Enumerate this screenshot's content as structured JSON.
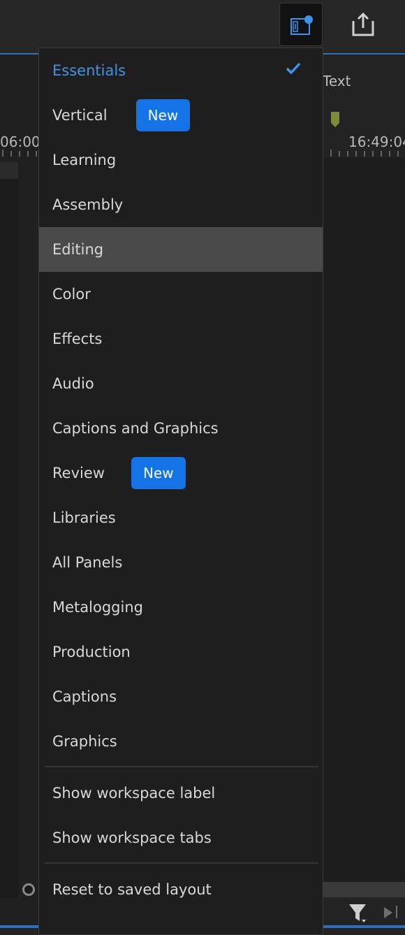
{
  "top_bar": {
    "workspaces_icon": "workspaces-icon",
    "share_icon": "share-export-icon",
    "accent_color": "#2c70c4"
  },
  "timeline": {
    "left_time": "06:00",
    "right_time": "16:49:04",
    "text_tab": "Text"
  },
  "menu": {
    "workspaces": [
      {
        "label": "Essentials",
        "selected": true,
        "badge": ""
      },
      {
        "label": "Vertical",
        "badge": "New"
      },
      {
        "label": "Learning",
        "badge": ""
      },
      {
        "label": "Assembly",
        "badge": ""
      },
      {
        "label": "Editing",
        "hover": true,
        "badge": ""
      },
      {
        "label": "Color",
        "badge": ""
      },
      {
        "label": "Effects",
        "badge": ""
      },
      {
        "label": "Audio",
        "badge": ""
      },
      {
        "label": "Captions and Graphics",
        "badge": ""
      },
      {
        "label": "Review",
        "badge": "New"
      },
      {
        "label": "Libraries",
        "badge": ""
      },
      {
        "label": "All Panels",
        "badge": ""
      },
      {
        "label": "Metalogging",
        "badge": ""
      },
      {
        "label": "Production",
        "badge": ""
      },
      {
        "label": "Captions",
        "badge": ""
      },
      {
        "label": "Graphics",
        "badge": ""
      }
    ],
    "options": [
      {
        "label": "Show workspace label"
      },
      {
        "label": "Show workspace tabs"
      }
    ],
    "reset": {
      "label": "Reset to saved layout"
    },
    "selected_color": "#3d95ea",
    "badge_color": "#1473e6",
    "check_icon": "checkmark-icon"
  }
}
